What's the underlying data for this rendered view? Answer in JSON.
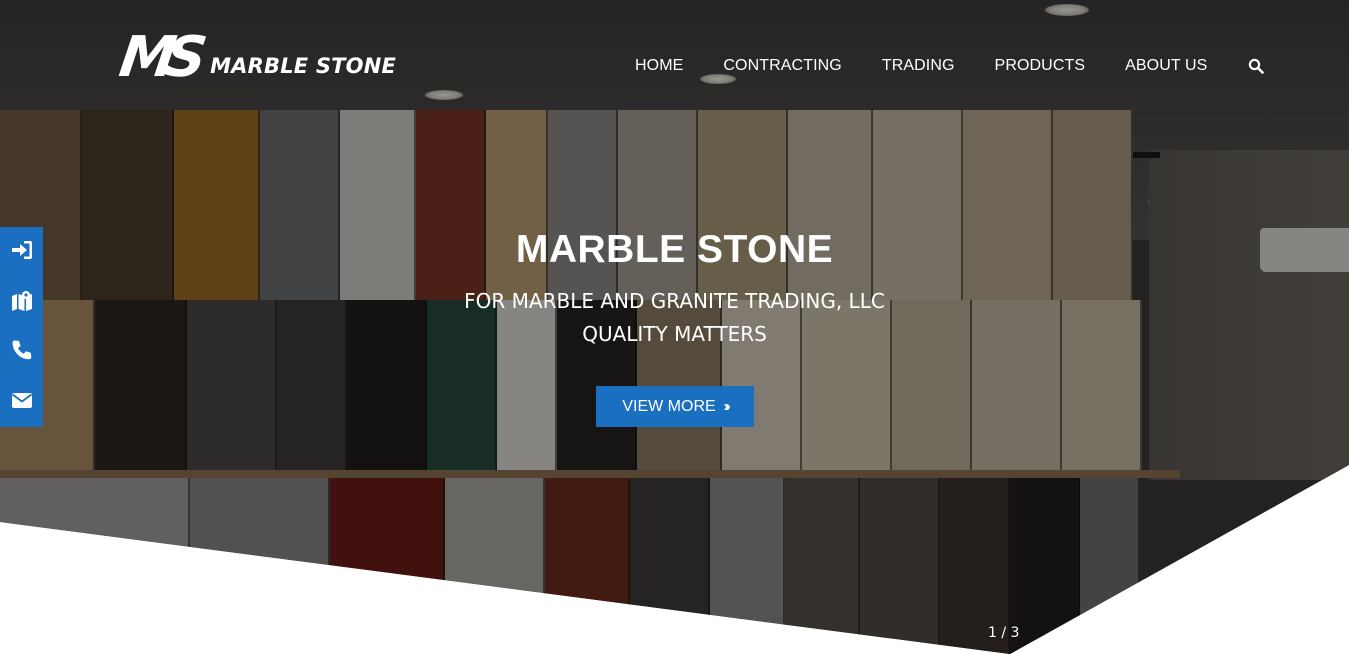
{
  "brand": {
    "logo_mark": "MS",
    "name": "MARBLE STONE"
  },
  "nav": {
    "items": [
      {
        "label": "HOME"
      },
      {
        "label": "CONTRACTING"
      },
      {
        "label": "TRADING"
      },
      {
        "label": "PRODUCTS"
      },
      {
        "label": "ABOUT US"
      }
    ],
    "search_icon": "search-icon"
  },
  "sidebar": {
    "icons": [
      "sign-in-icon",
      "map-icon",
      "phone-icon",
      "envelope-icon"
    ],
    "color": "#1a6fc0"
  },
  "hero": {
    "title": "MARBLE STONE",
    "subtitle_line1": "FOR MARBLE AND GRANITE TRADING, LLC",
    "subtitle_line2": "QUALITY MATTERS",
    "button_label": "VIEW MORE",
    "button_icon": "double-chevron-right-icon",
    "slide_counter": "1 / 3"
  },
  "colors": {
    "accent": "#1a6fc0",
    "text": "#ffffff"
  }
}
